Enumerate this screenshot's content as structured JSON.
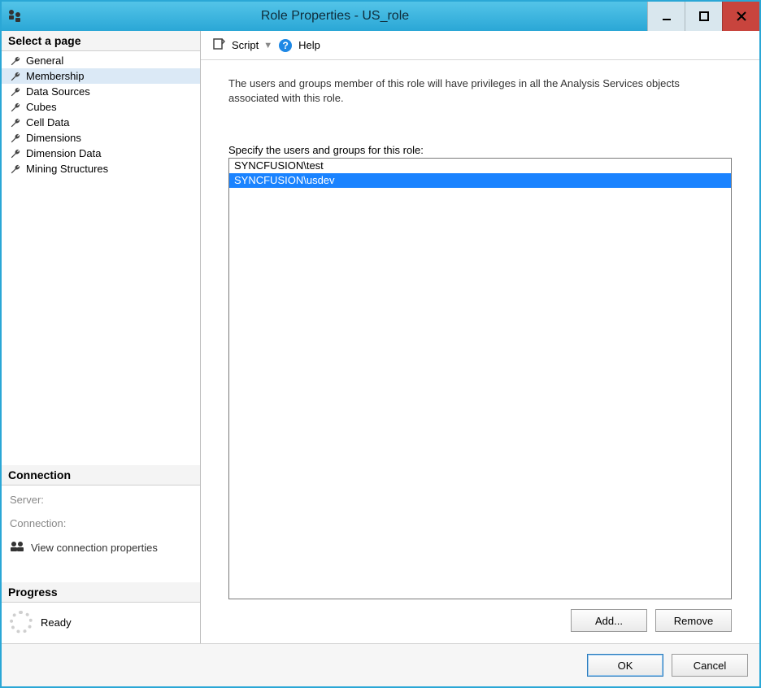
{
  "window": {
    "title": "Role Properties - US_role"
  },
  "sidebar": {
    "select_page_header": "Select a page",
    "pages": [
      {
        "label": "General",
        "selected": false
      },
      {
        "label": "Membership",
        "selected": true
      },
      {
        "label": "Data Sources",
        "selected": false
      },
      {
        "label": "Cubes",
        "selected": false
      },
      {
        "label": "Cell Data",
        "selected": false
      },
      {
        "label": "Dimensions",
        "selected": false
      },
      {
        "label": "Dimension Data",
        "selected": false
      },
      {
        "label": "Mining Structures",
        "selected": false
      }
    ],
    "connection_header": "Connection",
    "server_label": "Server:",
    "server_value": "",
    "connection_label": "Connection:",
    "connection_value": "",
    "view_connection_properties": "View connection properties",
    "progress_header": "Progress",
    "progress_status": "Ready"
  },
  "toolbar": {
    "script_label": "Script",
    "help_label": "Help"
  },
  "content": {
    "description": "The users and groups member of this role will have privileges in all the Analysis Services objects associated with this role.",
    "list_label": "Specify the users and groups for this role:",
    "users": [
      {
        "name": "SYNCFUSION\\test",
        "selected": false
      },
      {
        "name": "SYNCFUSION\\usdev",
        "selected": true
      }
    ],
    "add_label": "Add...",
    "remove_label": "Remove"
  },
  "footer": {
    "ok_label": "OK",
    "cancel_label": "Cancel"
  }
}
